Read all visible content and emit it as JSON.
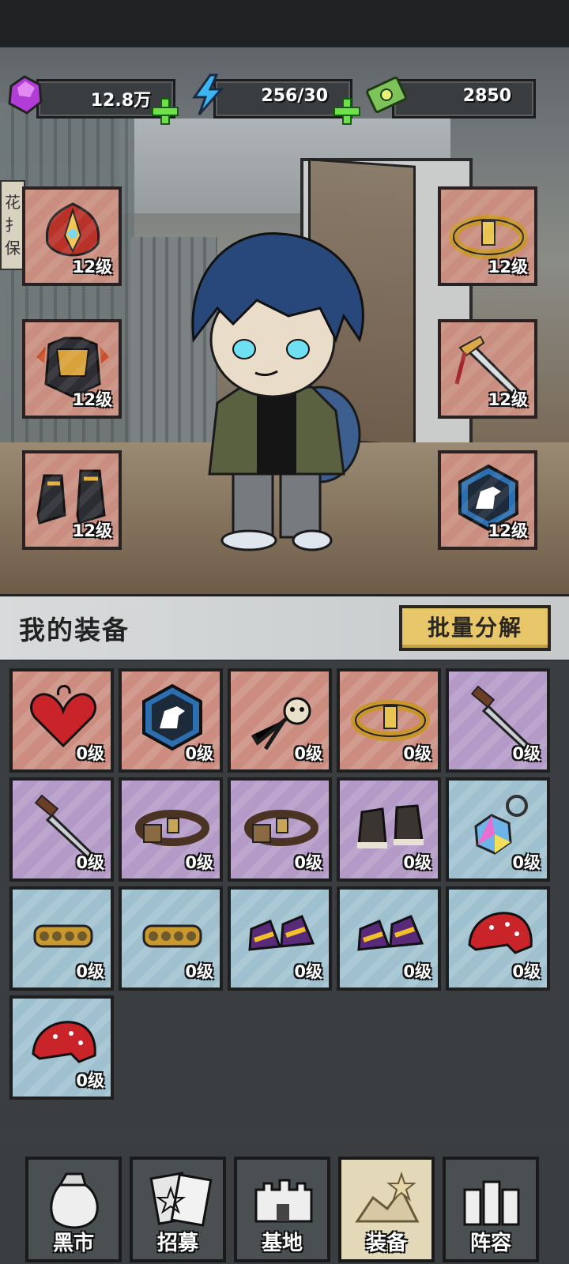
{
  "resources": {
    "gems": "12.8万",
    "energy": "256/30",
    "cash": "2850"
  },
  "scene_sign": "花扌保",
  "equipped": {
    "left": [
      {
        "icon": "flame-helmet-icon",
        "level": "12级"
      },
      {
        "icon": "armor-chestplate-icon",
        "level": "12级"
      },
      {
        "icon": "armored-boots-icon",
        "level": "12级"
      }
    ],
    "right": [
      {
        "icon": "gold-belt-icon",
        "level": "12级"
      },
      {
        "icon": "ornate-dagger-icon",
        "level": "12级"
      },
      {
        "icon": "dino-badge-icon",
        "level": "12级"
      }
    ]
  },
  "equipment_header": {
    "title": "我的装备",
    "batch_button": "批量分解"
  },
  "inventory": [
    {
      "icon": "heart-locket-icon",
      "level": "0级",
      "rarity": "red"
    },
    {
      "icon": "dino-badge-icon",
      "level": "0级",
      "rarity": "red"
    },
    {
      "icon": "skull-tassel-icon",
      "level": "0级",
      "rarity": "red"
    },
    {
      "icon": "gold-belt-icon",
      "level": "0级",
      "rarity": "red"
    },
    {
      "icon": "combat-knife-icon",
      "level": "0级",
      "rarity": "purple"
    },
    {
      "icon": "combat-knife-icon",
      "level": "0级",
      "rarity": "purple"
    },
    {
      "icon": "utility-belt-icon",
      "level": "0级",
      "rarity": "purple"
    },
    {
      "icon": "utility-belt-icon",
      "level": "0级",
      "rarity": "purple"
    },
    {
      "icon": "work-boots-icon",
      "level": "0级",
      "rarity": "purple"
    },
    {
      "icon": "crystal-keychain-icon",
      "level": "0级",
      "rarity": "blue"
    },
    {
      "icon": "brass-knuckles-icon",
      "level": "0级",
      "rarity": "blue"
    },
    {
      "icon": "brass-knuckles-icon",
      "level": "0级",
      "rarity": "blue"
    },
    {
      "icon": "purple-sneakers-icon",
      "level": "0级",
      "rarity": "blue"
    },
    {
      "icon": "purple-sneakers-icon",
      "level": "0级",
      "rarity": "blue"
    },
    {
      "icon": "red-bandana-icon",
      "level": "0级",
      "rarity": "blue"
    },
    {
      "icon": "red-bandana-icon",
      "level": "0级",
      "rarity": "blue"
    }
  ],
  "nav": [
    {
      "label": "黑市",
      "icon": "money-bag-icon",
      "active": false
    },
    {
      "label": "招募",
      "icon": "cards-icon",
      "active": false
    },
    {
      "label": "基地",
      "icon": "fortress-icon",
      "active": false
    },
    {
      "label": "装备",
      "icon": "gear-pile-icon",
      "active": true
    },
    {
      "label": "阵容",
      "icon": "squad-icon",
      "active": false
    }
  ],
  "colors": {
    "rarity_red": "#cc8d80",
    "rarity_purple": "#b39ac7",
    "rarity_blue": "#9fc0cf",
    "plus_green": "#6ee14a",
    "button_gold": "#e8c76a"
  }
}
